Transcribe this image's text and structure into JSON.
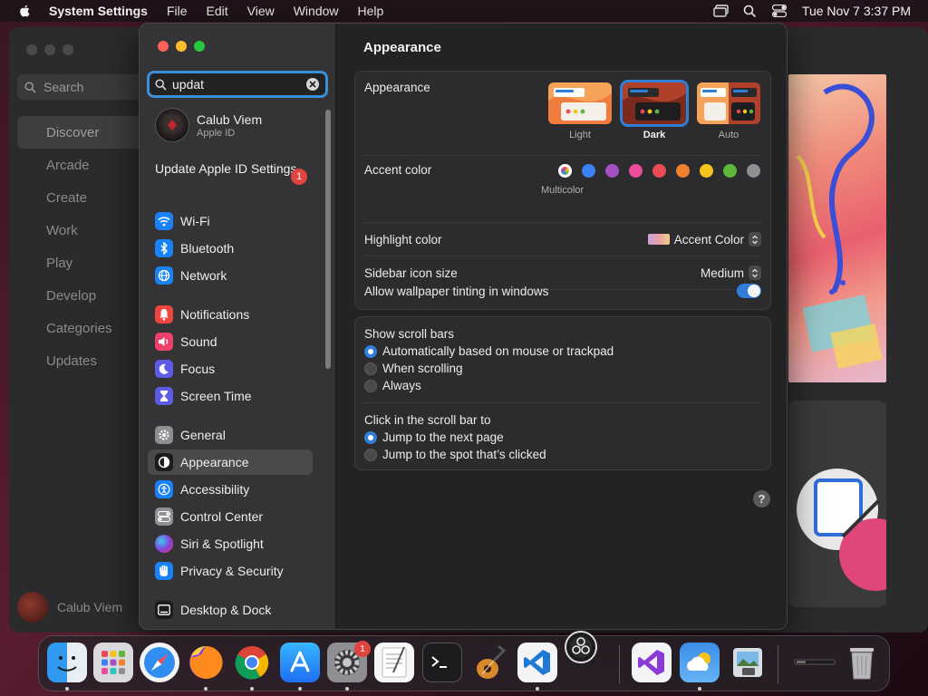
{
  "menubar": {
    "app_name": "System Settings",
    "items": [
      "File",
      "Edit",
      "View",
      "Window",
      "Help"
    ],
    "clock": "Tue Nov 7  3:37 PM"
  },
  "background_app": {
    "search_placeholder": "Search",
    "nav": [
      "Discover",
      "Arcade",
      "Create",
      "Work",
      "Play",
      "Develop",
      "Categories",
      "Updates"
    ],
    "active_nav": "Discover",
    "user_name": "Calub Viem"
  },
  "sidebar": {
    "search_value": "updat",
    "account": {
      "name": "Calub Viem",
      "subtitle": "Apple ID"
    },
    "update_notice": {
      "label": "Update Apple ID Settings",
      "badge": "1"
    },
    "items": [
      {
        "label": "Wi-Fi",
        "icon": "wifi-icon",
        "color": "#1a82f7"
      },
      {
        "label": "Bluetooth",
        "icon": "bluetooth-icon",
        "color": "#1a82f7"
      },
      {
        "label": "Network",
        "icon": "globe-icon",
        "color": "#1a82f7"
      },
      {
        "label": "Notifications",
        "icon": "bell-icon",
        "color": "#f0443e"
      },
      {
        "label": "Sound",
        "icon": "speaker-icon",
        "color": "#ef3f6b"
      },
      {
        "label": "Focus",
        "icon": "moon-icon",
        "color": "#5e5ce6"
      },
      {
        "label": "Screen Time",
        "icon": "hourglass-icon",
        "color": "#5e5ce6"
      },
      {
        "label": "General",
        "icon": "gear-icon",
        "color": "#8e8e93"
      },
      {
        "label": "Appearance",
        "icon": "appearance-icon",
        "color": "#1c1c1e"
      },
      {
        "label": "Accessibility",
        "icon": "accessibility-icon",
        "color": "#1a82f7"
      },
      {
        "label": "Control Center",
        "icon": "control-center-icon",
        "color": "#8e8e93"
      },
      {
        "label": "Siri & Spotlight",
        "icon": "siri-icon",
        "color": "#8a3dd9"
      },
      {
        "label": "Privacy & Security",
        "icon": "hand-icon",
        "color": "#1a82f7"
      },
      {
        "label": "Desktop & Dock",
        "icon": "desktop-icon",
        "color": "#1c1c1e"
      }
    ],
    "selected": "Appearance"
  },
  "main": {
    "title": "Appearance",
    "appearance": {
      "label": "Appearance",
      "options": [
        "Light",
        "Dark",
        "Auto"
      ],
      "selected": "Dark"
    },
    "accent": {
      "label": "Accent color",
      "multicolor_label": "Multicolor",
      "colors": [
        "#3b82f6",
        "#a350c4",
        "#ec4c9a",
        "#ec4a55",
        "#f0812a",
        "#f6c31c",
        "#5fb83a",
        "#8e8e93"
      ]
    },
    "highlight": {
      "label": "Highlight color",
      "value": "Accent Color"
    },
    "sidebar_icon_size": {
      "label": "Sidebar icon size",
      "value": "Medium"
    },
    "wallpaper_tinting": {
      "label": "Allow wallpaper tinting in windows",
      "on": true
    },
    "scroll_bars": {
      "label": "Show scroll bars",
      "options": [
        "Automatically based on mouse or trackpad",
        "When scrolling",
        "Always"
      ],
      "selected": 0
    },
    "click_scroll": {
      "label": "Click in the scroll bar to",
      "options": [
        "Jump to the next page",
        "Jump to the spot that’s clicked"
      ],
      "selected": 0
    },
    "help_symbol": "?"
  },
  "dock": {
    "apps": [
      "Finder",
      "Launchpad",
      "Safari",
      "Firefox",
      "Chrome",
      "App Store",
      "System Settings",
      "TextEdit",
      "Terminal",
      "GarageBand",
      "Visual Studio Code",
      "OBS",
      "Visual Studio",
      "Weather",
      "Preview",
      "Trash"
    ],
    "system_settings_badge": "1"
  }
}
